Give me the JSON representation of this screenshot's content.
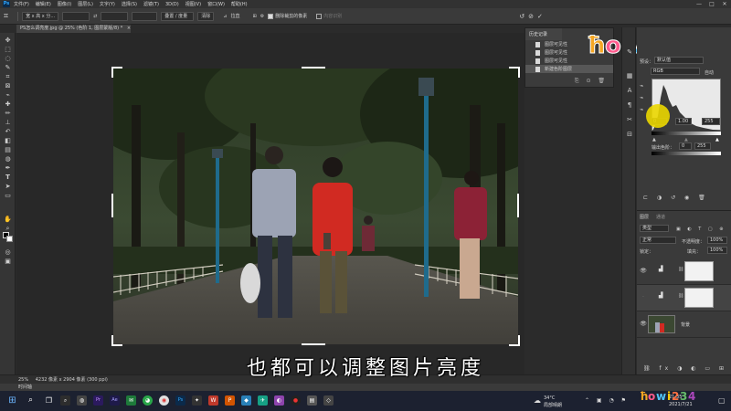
{
  "menubar": {
    "app_logo": "Ps",
    "items": [
      "文件(F)",
      "编辑(E)",
      "图像(I)",
      "图层(L)",
      "文字(Y)",
      "选择(S)",
      "滤镜(T)",
      "3D(D)",
      "视图(V)",
      "窗口(W)",
      "帮助(H)"
    ],
    "minimize": "—",
    "maximize": "□",
    "close": "✕"
  },
  "optionsbar": {
    "ratio_select": "宽 x 高 x 分...",
    "swap_icon": "⇄",
    "clear": "清除",
    "straighten": "拉直",
    "overlay_select": "叠置 / 度量",
    "delete_cropped_label": "删除裁剪的像素",
    "content_aware": "内容识别",
    "reset_icon": "↺",
    "cancel_icon": "⊘",
    "commit_icon": "✓"
  },
  "document_tab": {
    "title": "PS怎么调亮度.jpg @ 25% (色阶 1, 图层蒙版/8) *",
    "close": "×"
  },
  "history_panel": {
    "tab": "历史记录",
    "items": [
      {
        "label": "图层可见性",
        "selected": false
      },
      {
        "label": "图层可见性",
        "selected": false
      },
      {
        "label": "图层可见性",
        "selected": false
      },
      {
        "label": "新建色阶图层",
        "selected": true
      }
    ],
    "footer_icons": "⎘ ⊙ 🗑"
  },
  "properties_panel": {
    "preset_label": "预设：",
    "preset_value": "默认值",
    "channel_value": "RGB",
    "auto_button": "自动",
    "input_shadow": "0",
    "input_gamma": "1.00",
    "input_highlight": "255",
    "output_label": "输出色阶：",
    "output_min": "0",
    "output_max": "255"
  },
  "layers_panel": {
    "tab_layers": "图层",
    "tab_channels": "通道",
    "filter_label": "类型",
    "blend_mode": "正常",
    "opacity_label": "不透明度：",
    "opacity_value": "100%",
    "lock_label": "锁定：",
    "fill_label": "填充：",
    "fill_value": "100%",
    "background_layer": "背景"
  },
  "statusbar": {
    "zoom": "25%",
    "doc_info": "4232 像素 x 2904 像素 (300 ppi)"
  },
  "timeline": {
    "label": "时间轴"
  },
  "subtitle": "也都可以调整图片亮度",
  "taskbar": {
    "temperature": "34°C",
    "weather": "局部晴朗",
    "time": "21:35",
    "date": "2021/7/21"
  },
  "colors": {
    "ps_accent": "#31a8ff",
    "taskbar_bg": "#1c2130",
    "shirt_red": "#d12a22"
  }
}
